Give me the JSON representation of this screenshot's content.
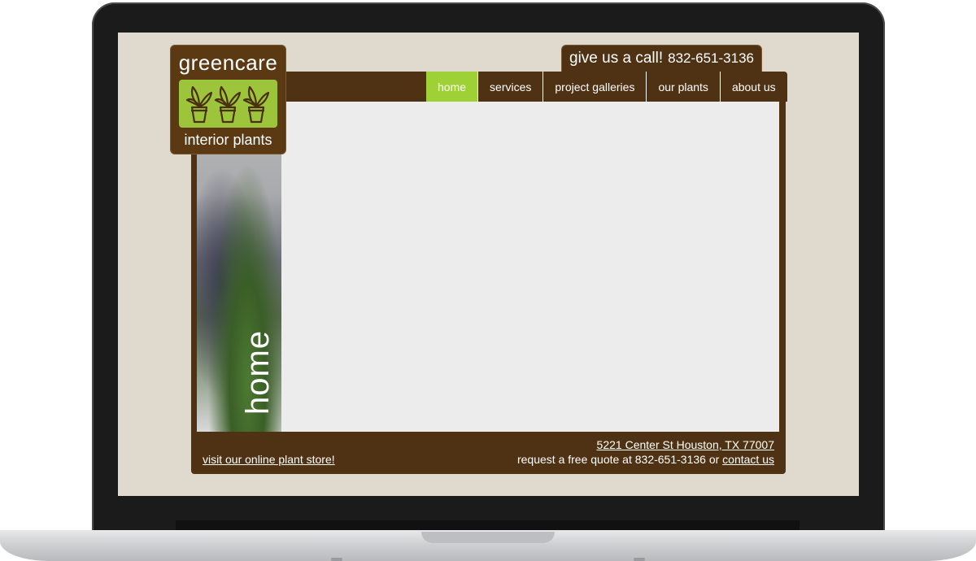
{
  "site": {
    "logo": {
      "top_text": "greencare",
      "bottom_text": "interior plants",
      "icon": "potted-plants-icon"
    },
    "call": {
      "label": "give us a call!",
      "phone": "832-651-3136"
    },
    "nav": [
      {
        "label": "home",
        "active": true
      },
      {
        "label": "services",
        "active": false
      },
      {
        "label": "project galleries",
        "active": false
      },
      {
        "label": "our plants",
        "active": false
      },
      {
        "label": "about us",
        "active": false
      }
    ],
    "section_title": "home",
    "footer": {
      "store_link": "visit our online plant store!",
      "address": "5221 Center St Houston, TX 77007",
      "quote_prefix": "request a free quote at",
      "quote_phone": "832-651-3136",
      "quote_or": "or",
      "contact_link": "contact us"
    }
  },
  "colors": {
    "brown": "#4f3213",
    "green_accent": "#9dd136",
    "logo_green": "#9dc53b",
    "screen_bg": "#e0d9ce",
    "content_bg": "#ececec"
  }
}
